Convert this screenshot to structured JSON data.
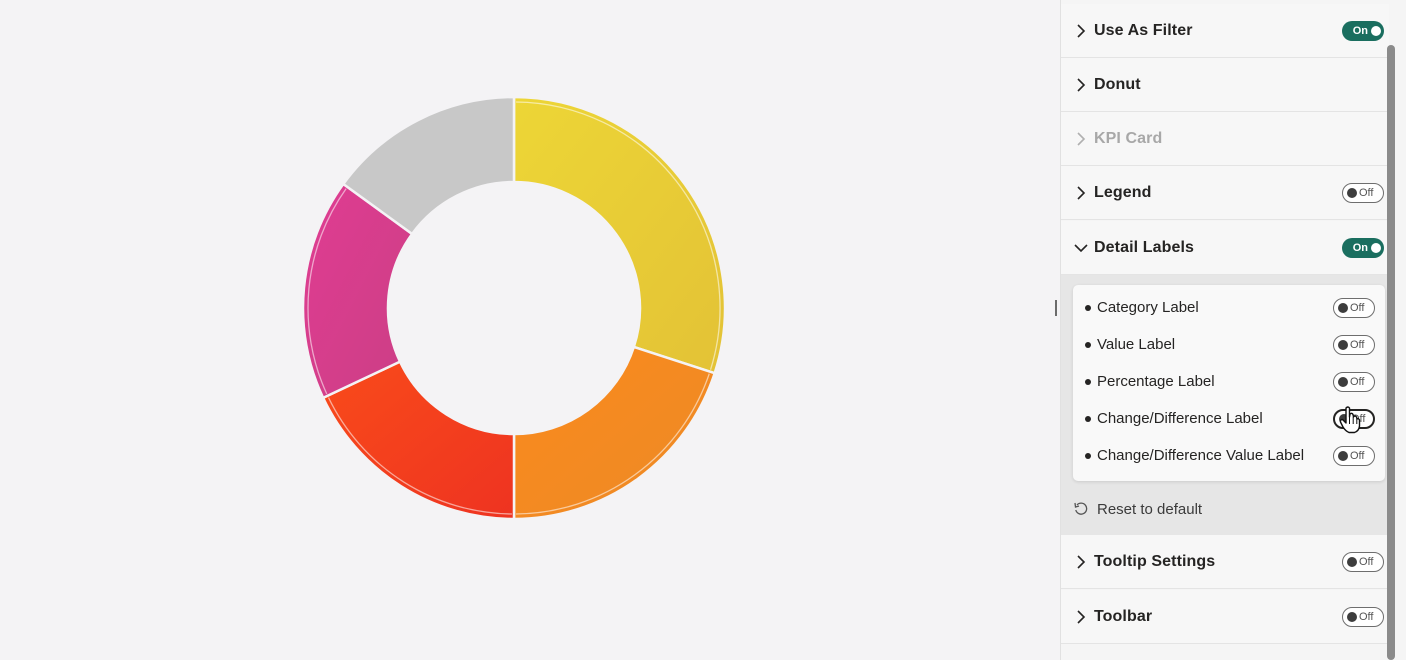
{
  "panel": {
    "sections": [
      {
        "title": "Use As Filter",
        "toggle": "on",
        "toggle_label": "On"
      },
      {
        "title": "Donut",
        "toggle": null
      },
      {
        "title": "KPI Card",
        "toggle": null,
        "disabled": true
      },
      {
        "title": "Legend",
        "toggle": "off",
        "toggle_label": "Off"
      },
      {
        "title": "Detail Labels",
        "toggle": "on",
        "toggle_label": "On",
        "expanded": true
      }
    ],
    "detail_labels": [
      {
        "label": "Category Label",
        "toggle_label": "Off"
      },
      {
        "label": "Value Label",
        "toggle_label": "Off"
      },
      {
        "label": "Percentage Label",
        "toggle_label": "Off"
      },
      {
        "label": "Change/Difference Label",
        "toggle_label": "Off"
      },
      {
        "label": "Change/Difference Value Label",
        "toggle_label": "Off"
      }
    ],
    "reset_label": "Reset to default",
    "lower_sections": [
      {
        "title": "Tooltip Settings",
        "toggle": "off",
        "toggle_label": "Off"
      },
      {
        "title": "Toolbar",
        "toggle": "off",
        "toggle_label": "Off"
      }
    ]
  },
  "chart_data": {
    "type": "pie",
    "variant": "donut",
    "segments": [
      {
        "value": 30,
        "color": "#e8cc33"
      },
      {
        "value": 20,
        "color": "#f58a1f"
      },
      {
        "value": 18,
        "color": "#f5421e"
      },
      {
        "value": 17,
        "color": "#d83a8c"
      },
      {
        "value": 15,
        "color": "#c8c8c8"
      }
    ],
    "legend": "hidden",
    "labels": "hidden"
  }
}
